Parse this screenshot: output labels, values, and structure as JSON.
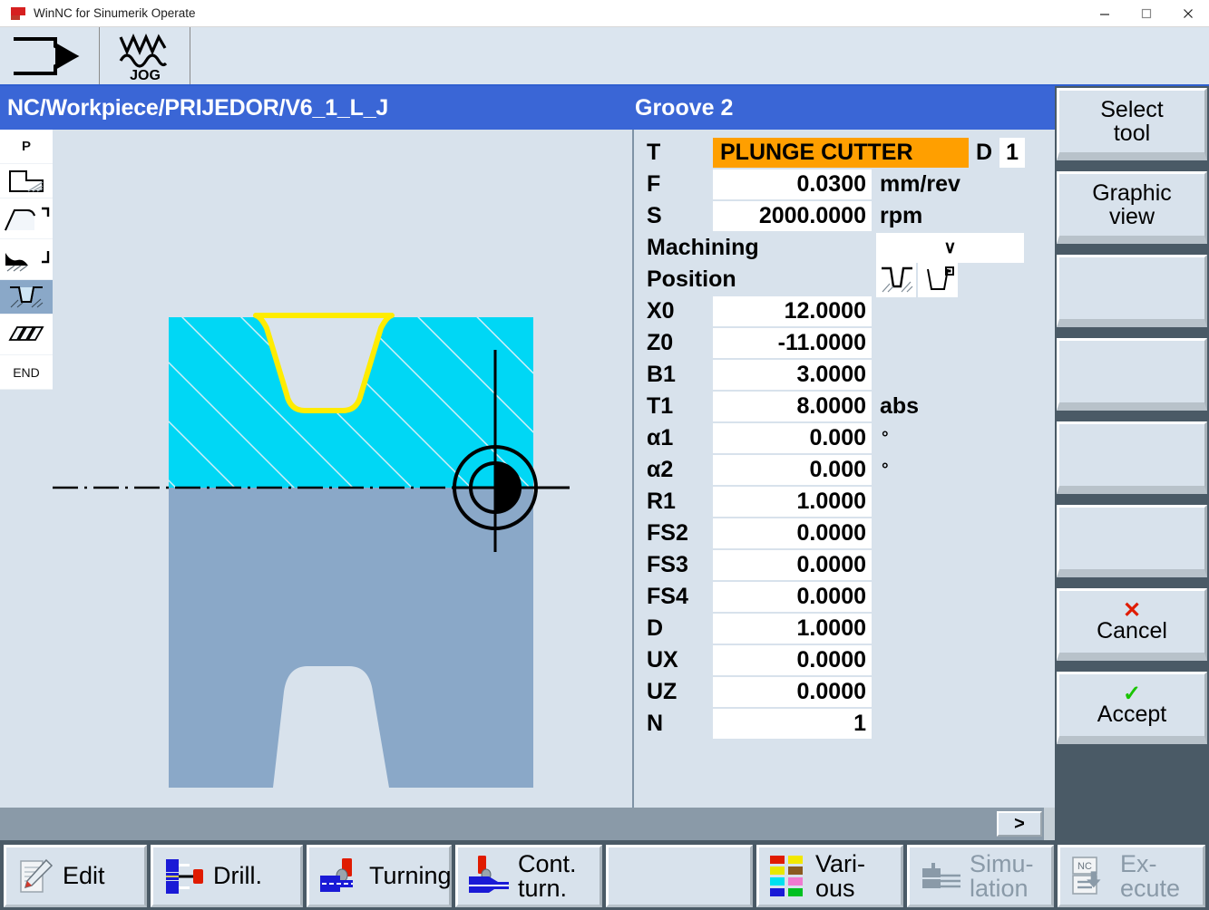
{
  "window": {
    "title": "WinNC for Sinumerik Operate",
    "controls": {
      "minimize": "minimize-icon",
      "maximize": "maximize-icon",
      "close": "close-icon"
    }
  },
  "modebar": {
    "items": [
      {
        "name": "machine-mode-icon",
        "label": ""
      },
      {
        "name": "jog-mode-icon",
        "label": "JOG"
      }
    ]
  },
  "header": {
    "path": "NC/Workpiece/PRIJEDOR/V6_1_L_J",
    "operation": "Groove 2"
  },
  "step_strip": {
    "items": [
      {
        "name": "step-program-header",
        "label": "P",
        "selected": false
      },
      {
        "name": "step-blank-stock",
        "label": "",
        "selected": false
      },
      {
        "name": "step-contour",
        "label": "",
        "selected": false
      },
      {
        "name": "step-stock-removal",
        "label": "",
        "selected": false
      },
      {
        "name": "step-groove",
        "label": "",
        "selected": true
      },
      {
        "name": "step-thread",
        "label": "",
        "selected": false
      },
      {
        "name": "step-end",
        "label": "END",
        "selected": false
      }
    ]
  },
  "form": {
    "tool": {
      "label": "T",
      "value": "PLUNGE CUTTER",
      "d_label": "D",
      "d_value": "1"
    },
    "rows": [
      {
        "label": "F",
        "value": "0.0300",
        "unit": "mm/rev"
      },
      {
        "label": "S",
        "value": "2000.0000",
        "unit": "rpm"
      }
    ],
    "machining": {
      "label": "Machining",
      "value": "",
      "chevron": "∨"
    },
    "position": {
      "label": "Position",
      "icons": [
        "groove-in-material-icon",
        "groove-tool-icon"
      ],
      "selected_index": 0
    },
    "params": [
      {
        "label": "X0",
        "value": "12.0000",
        "unit": ""
      },
      {
        "label": "Z0",
        "value": "-11.0000",
        "unit": ""
      },
      {
        "label": "B1",
        "value": "3.0000",
        "unit": ""
      },
      {
        "label": "T1",
        "value": "8.0000",
        "unit": "abs"
      },
      {
        "label": "α1",
        "value": "0.000",
        "unit": "°"
      },
      {
        "label": "α2",
        "value": "0.000",
        "unit": "°"
      },
      {
        "label": "R1",
        "value": "1.0000",
        "unit": ""
      },
      {
        "label": "FS2",
        "value": "0.0000",
        "unit": ""
      },
      {
        "label": "FS3",
        "value": "0.0000",
        "unit": ""
      },
      {
        "label": "FS4",
        "value": "0.0000",
        "unit": ""
      },
      {
        "label": "D",
        "value": "1.0000",
        "unit": ""
      },
      {
        "label": "UX",
        "value": "0.0000",
        "unit": ""
      },
      {
        "label": "UZ",
        "value": "0.0000",
        "unit": ""
      },
      {
        "label": "N",
        "value": "1",
        "unit": ""
      }
    ]
  },
  "status": {
    "menu_extension": ">"
  },
  "softkeys_vertical": [
    {
      "name": "softkey-select-tool",
      "line1": "Select",
      "line2": "tool",
      "icon": ""
    },
    {
      "name": "softkey-graphic-view",
      "line1": "Graphic",
      "line2": "view",
      "icon": ""
    },
    {
      "name": "softkey-empty-3",
      "line1": "",
      "line2": "",
      "icon": ""
    },
    {
      "name": "softkey-empty-4",
      "line1": "",
      "line2": "",
      "icon": ""
    },
    {
      "name": "softkey-empty-5",
      "line1": "",
      "line2": "",
      "icon": ""
    },
    {
      "name": "softkey-empty-6",
      "line1": "",
      "line2": "",
      "icon": ""
    },
    {
      "name": "softkey-cancel",
      "line1": "Cancel",
      "line2": "",
      "icon": "✕"
    },
    {
      "name": "softkey-accept",
      "line1": "Accept",
      "line2": "",
      "icon": "✓"
    }
  ],
  "softkeys_bottom": [
    {
      "name": "softkey-edit",
      "line1": "Edit",
      "line2": "",
      "icon": "edit-pencil-icon",
      "disabled": false
    },
    {
      "name": "softkey-drill",
      "line1": "Drill.",
      "line2": "",
      "icon": "drill-icon",
      "disabled": false
    },
    {
      "name": "softkey-turning",
      "line1": "Turning",
      "line2": "",
      "icon": "turning-icon",
      "disabled": false
    },
    {
      "name": "softkey-contour-turn",
      "line1": "Cont.",
      "line2": "turn.",
      "icon": "contour-turn-icon",
      "disabled": false
    },
    {
      "name": "softkey-empty-bottom",
      "line1": "",
      "line2": "",
      "icon": "",
      "disabled": false
    },
    {
      "name": "softkey-various",
      "line1": "Vari-",
      "line2": "ous",
      "icon": "various-icon",
      "disabled": false
    },
    {
      "name": "softkey-simulation",
      "line1": "Simu-",
      "line2": "lation",
      "icon": "simulation-icon",
      "disabled": true
    },
    {
      "name": "softkey-execute",
      "line1": "Ex-",
      "line2": "ecute",
      "icon": "nc-execute-icon",
      "disabled": true
    }
  ],
  "graphic": {
    "name": "workpiece-groove-cross-section",
    "colors": {
      "stock_cyan": "#00d7f5",
      "stock_blue_grey": "#8aa8c8",
      "contour_yellow": "#ffec00",
      "background": "#d8e2ec",
      "axis_black": "#000000"
    }
  },
  "colors": {
    "header_blue": "#3a66d6",
    "tool_highlight_orange": "#ff9f00",
    "softkey_face": "#d8e2ec",
    "softkey_bg": "#4a5a66",
    "cancel_red": "#e01b00",
    "accept_green": "#19c400"
  }
}
